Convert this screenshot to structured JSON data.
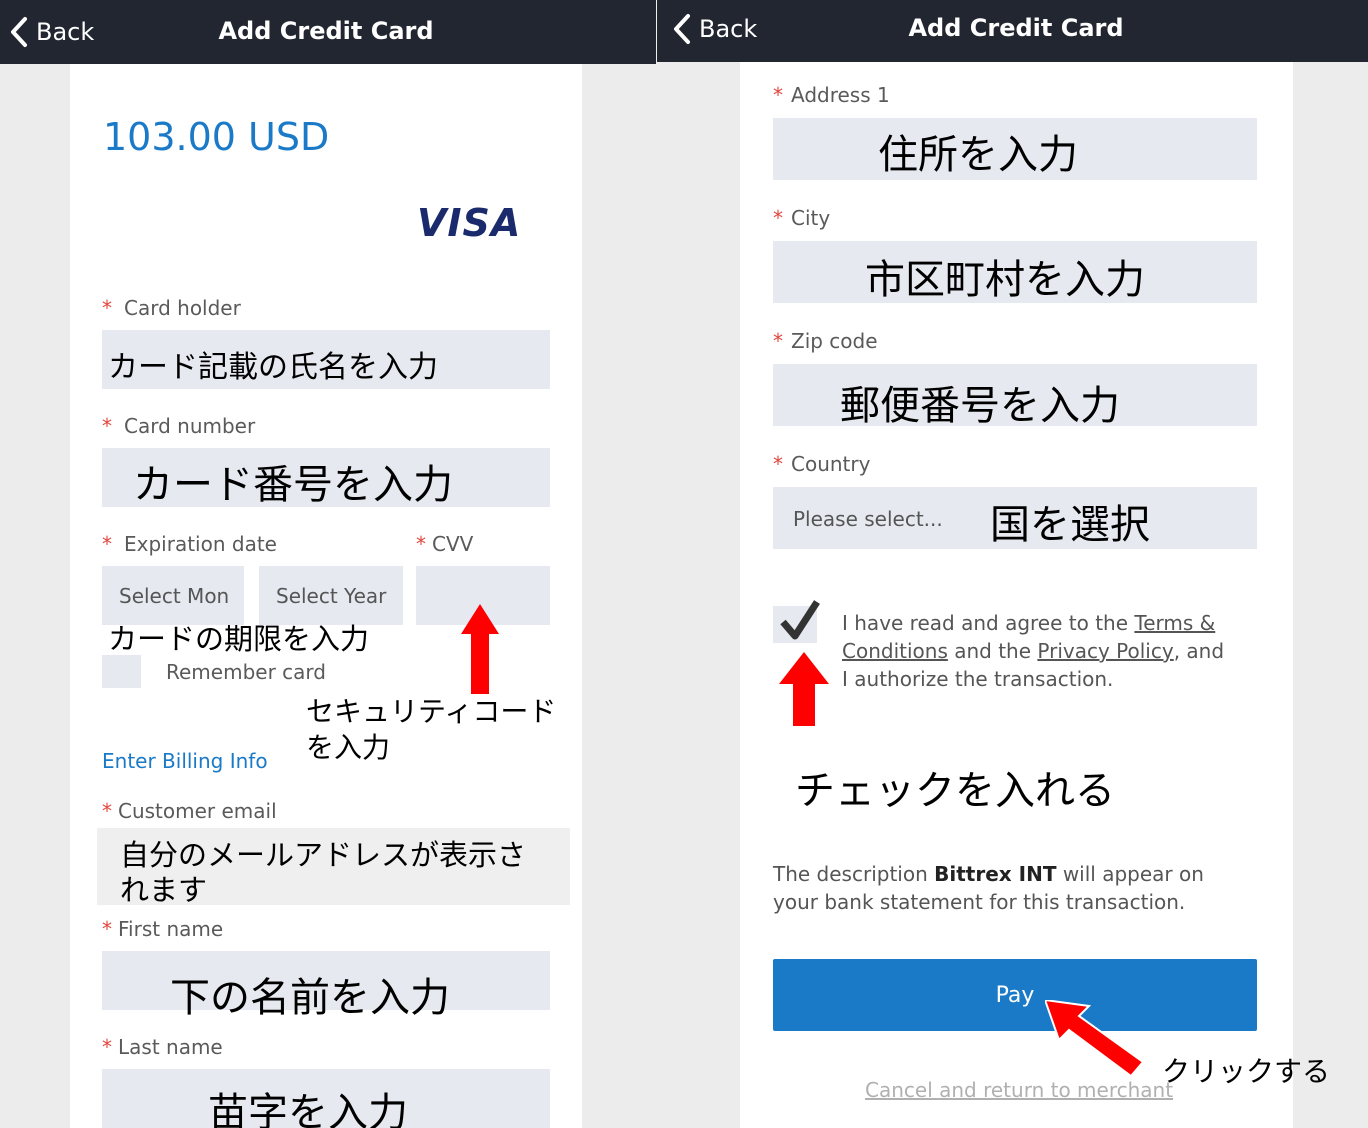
{
  "colors": {
    "topbar": "#212630",
    "accent": "#1a7ac8",
    "pay_button": "#1a7ac8",
    "field_bg": "#e6e9f0",
    "required_star": "#e0463c",
    "arrow": "#ff0000"
  },
  "left": {
    "back_label": "Back",
    "title": "Add Credit Card",
    "amount": "103.00 USD",
    "card_brand": "VISA",
    "card_holder": {
      "label": "Card holder",
      "annotation": "カード記載の氏名を入力"
    },
    "card_number": {
      "label": "Card number",
      "annotation": "カード番号を入力"
    },
    "expiration": {
      "label": "Expiration date",
      "month_placeholder": "Select Mon",
      "year_placeholder": "Select Year",
      "annotation": "カードの期限を入力"
    },
    "cvv": {
      "label": "CVV",
      "annotation_line1": "セキュリティコード",
      "annotation_line2": "を入力"
    },
    "remember_label": "Remember card",
    "billing_link": "Enter Billing Info",
    "customer_email": {
      "label": "Customer email",
      "annotation_line1": "自分のメールアドレスが表示さ",
      "annotation_line2": "れます"
    },
    "first_name": {
      "label": "First name",
      "annotation": "下の名前を入力"
    },
    "last_name": {
      "label": "Last name",
      "annotation": "苗字を入力"
    }
  },
  "right": {
    "back_label": "Back",
    "title": "Add Credit Card",
    "address1": {
      "label": "Address 1",
      "annotation": "住所を入力"
    },
    "city": {
      "label": "City",
      "annotation": "市区町村を入力"
    },
    "zip": {
      "label": "Zip code",
      "annotation": "郵便番号を入力"
    },
    "country": {
      "label": "Country",
      "placeholder": "Please select...",
      "annotation": "国を選択"
    },
    "agree": {
      "text1": "I have read and agree to the ",
      "terms_link_1": "Terms &",
      "terms_link_2": "Conditions",
      "text2": " and the ",
      "privacy_link": "Privacy Policy",
      "text3": ", and",
      "text4": "I authorize the transaction.",
      "annotation": "チェックを入れる"
    },
    "description": {
      "prefix": "The description ",
      "merchant": "Bittrex INT",
      "suffix": " will appear on",
      "line2": "your bank statement for this transaction."
    },
    "pay_label": "Pay",
    "pay_annotation": "クリックする",
    "cancel_link": "Cancel and return to merchant"
  }
}
